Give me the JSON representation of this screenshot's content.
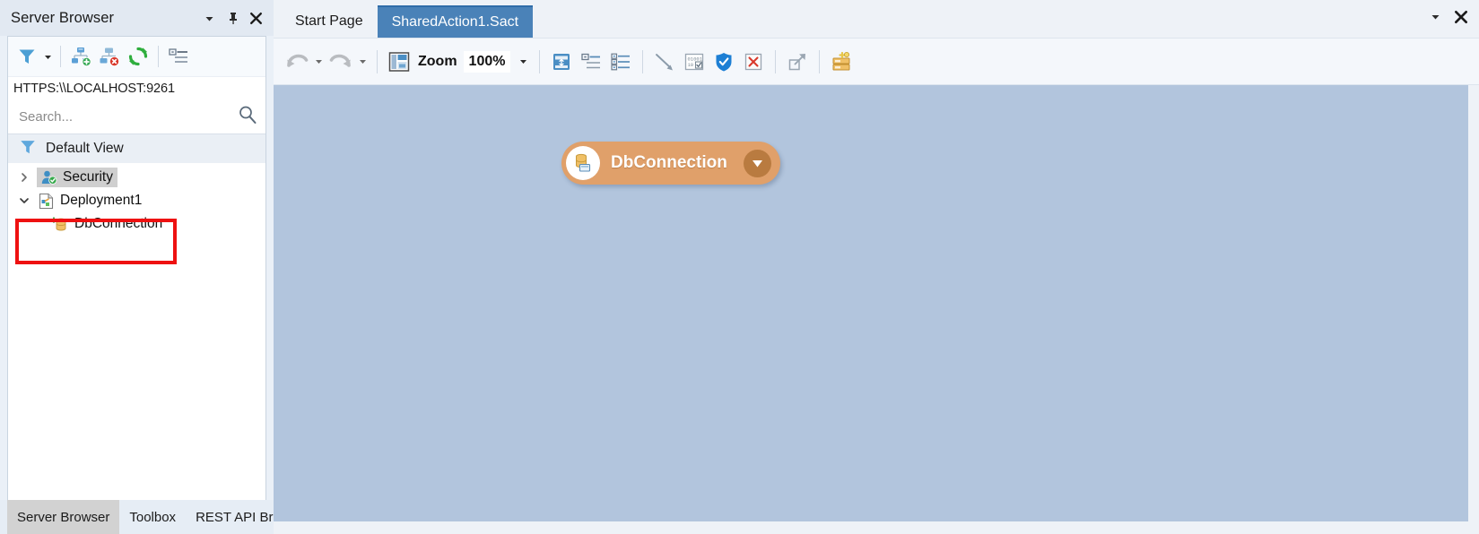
{
  "left_dock": {
    "title": "Server Browser",
    "title_buttons": [
      {
        "name": "dropdown-menu-icon",
        "glyph": "▾"
      },
      {
        "name": "pin-icon",
        "glyph": "pin"
      },
      {
        "name": "close-icon",
        "glyph": "✕"
      }
    ],
    "toolbar": [
      {
        "name": "filter-icon",
        "tooltip": "Filter"
      },
      {
        "name": "filter-dropdown-caret",
        "tooltip": "Filter options"
      },
      {
        "name": "add-server-icon",
        "tooltip": "Add Server"
      },
      {
        "name": "remove-server-icon",
        "tooltip": "Remove Server"
      },
      {
        "name": "refresh-icon",
        "tooltip": "Refresh"
      },
      {
        "name": "properties-list-icon",
        "tooltip": "Properties"
      }
    ],
    "url": "HTTPS:\\\\LOCALHOST:9261",
    "search": {
      "placeholder": "Search...",
      "value": "",
      "icon": "search-icon"
    },
    "default_view_label": "Default View",
    "tree": [
      {
        "label": "Security",
        "level": 1,
        "expander": "collapsed",
        "icon": "security-user-icon",
        "selected": true
      },
      {
        "label": "Deployment1",
        "level": 1,
        "expander": "expanded",
        "icon": "deployment-icon",
        "selected": false
      },
      {
        "label": "DbConnection",
        "level": 2,
        "expander": "none",
        "icon": "db-connection-icon",
        "selected": false
      }
    ],
    "bottom_tabs": [
      {
        "label": "Server Browser",
        "active": true
      },
      {
        "label": "Toolbox",
        "active": false
      },
      {
        "label": "REST API Bro...",
        "active": false
      }
    ]
  },
  "main": {
    "doc_tabs": [
      {
        "label": "Start Page",
        "active": false
      },
      {
        "label": "SharedAction1.Sact",
        "active": true
      }
    ],
    "doc_tab_buttons": [
      {
        "name": "document-list-dropdown-icon",
        "glyph": "▾"
      },
      {
        "name": "close-document-icon",
        "glyph": "✕"
      }
    ],
    "toolbar": {
      "undo": {
        "name": "undo-icon",
        "tooltip": "Undo"
      },
      "undo_caret": {
        "name": "undo-dropdown-caret",
        "tooltip": "Undo history"
      },
      "redo": {
        "name": "redo-icon",
        "tooltip": "Redo"
      },
      "redo_caret": {
        "name": "redo-dropdown-caret",
        "tooltip": "Redo history"
      },
      "zoom_icon": {
        "name": "zoom-layout-icon",
        "tooltip": "Zoom"
      },
      "zoom_label": "Zoom",
      "zoom_value": "100%",
      "zoom_caret": {
        "name": "zoom-dropdown-caret",
        "tooltip": "Zoom level"
      },
      "items": [
        {
          "name": "auto-size-icon",
          "tooltip": "Auto Size"
        },
        {
          "name": "align-outline-icon",
          "tooltip": "Outline"
        },
        {
          "name": "align-list-icon",
          "tooltip": "List"
        },
        {
          "name": "connector-line-icon",
          "tooltip": "Connector"
        },
        {
          "name": "data-grid-icon",
          "tooltip": "Data"
        },
        {
          "name": "security-shield-icon",
          "tooltip": "Security"
        },
        {
          "name": "delete-x-icon",
          "tooltip": "Delete"
        },
        {
          "name": "expand-arrow-icon",
          "tooltip": "Expand"
        },
        {
          "name": "db-stack-icon",
          "tooltip": "Database"
        }
      ]
    },
    "canvas": {
      "node": {
        "title": "DbConnection",
        "icon": "db-connection-node-icon",
        "dropdown_icon": "node-dropdown-icon",
        "color": "#e0a06a"
      }
    }
  },
  "colors": {
    "accent_blue": "#4a82b8",
    "canvas_bg": "#b2c5dd",
    "node_orange": "#e0a06a",
    "highlight_red": "#ee1111",
    "chrome_bg": "#eef2f7"
  }
}
